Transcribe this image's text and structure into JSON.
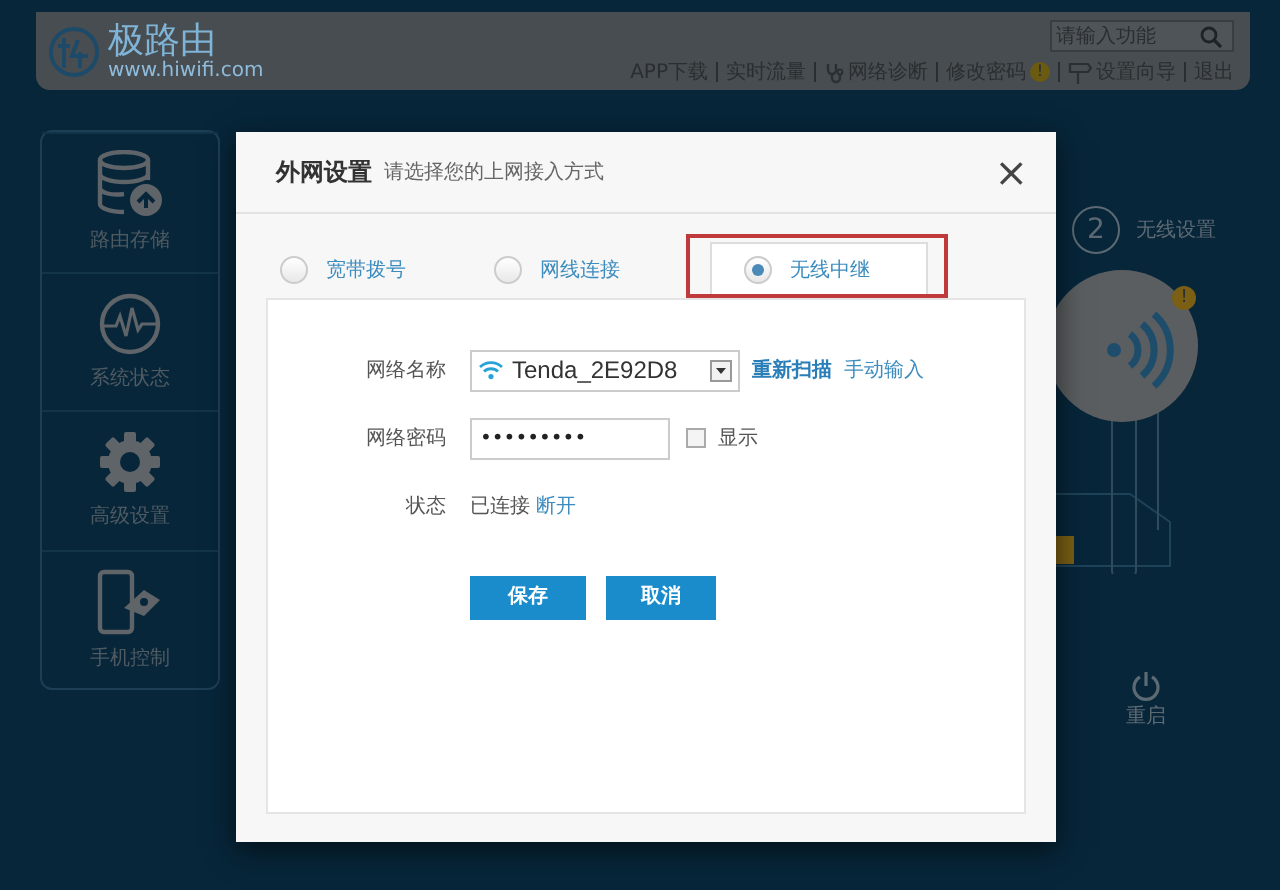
{
  "header": {
    "logo_text": "极路由",
    "logo_url": "www.hiwifi.com",
    "search": {
      "placeholder": "请输入功能"
    },
    "links": [
      {
        "label": "APP下载",
        "kind": "plain"
      },
      {
        "label": "实时流量",
        "kind": "plain"
      },
      {
        "label": "网络诊断",
        "kind": "diagnose"
      },
      {
        "label": "修改密码",
        "kind": "plain",
        "badge": "!"
      },
      {
        "label": "设置向导",
        "kind": "guide"
      },
      {
        "label": "退出",
        "kind": "plain"
      }
    ]
  },
  "sidebar": {
    "items": [
      {
        "label": "路由存储",
        "kind": "storage"
      },
      {
        "label": "系统状态",
        "kind": "status"
      },
      {
        "label": "高级设置",
        "kind": "settings"
      },
      {
        "label": "手机控制",
        "kind": "mobile"
      }
    ]
  },
  "wizard": {
    "step": "2",
    "label": "无线设置",
    "alert": "!",
    "reboot": "重启"
  },
  "dialog": {
    "title": "外网设置",
    "subtitle": "请选择您的上网接入方式",
    "close": "×",
    "tabs": [
      {
        "label": "宽带拨号",
        "selected": false,
        "highlighted": false
      },
      {
        "label": "网线连接",
        "selected": false,
        "highlighted": false
      },
      {
        "label": "无线中继",
        "selected": true,
        "highlighted": true
      }
    ],
    "network_name": {
      "label": "网络名称",
      "value": "Tenda_2E92D8",
      "rescan": "重新扫描",
      "manual": "手动输入"
    },
    "password": {
      "label": "网络密码",
      "value": "•••••••••",
      "show": {
        "label": "显示",
        "checked": false
      }
    },
    "status": {
      "label": "状态",
      "value": "已连接",
      "action": "断开"
    },
    "buttons": [
      {
        "label": "保存"
      },
      {
        "label": "取消"
      }
    ]
  }
}
